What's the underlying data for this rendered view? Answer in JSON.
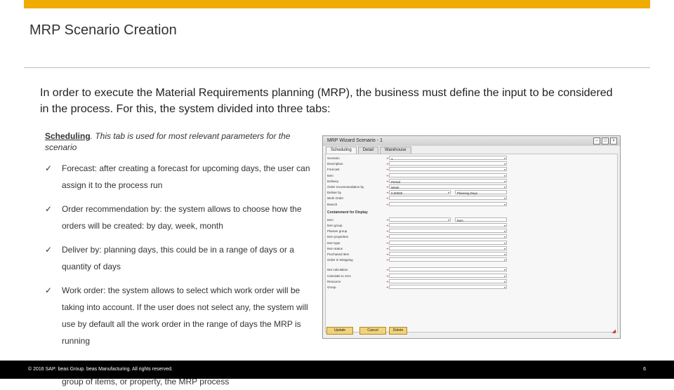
{
  "slide": {
    "title": "MRP Scenario Creation",
    "intro": "In order to execute the Material Requirements planning (MRP), the business must define the input to be considered in the process. For this, the system divided into three tabs:",
    "brand_color": "#f0ab00"
  },
  "scheduling": {
    "heading_underlined": "Scheduling",
    "heading_rest": ". This tab is used for most relevant parameters for the scenario",
    "bullets": [
      "Forecast: after creating a forecast for upcoming days, the user can assign it to the process run",
      "Order recommendation by: the system allows to choose how the orders will be created: by day, week, month",
      "Deliver by: planning days, this could be in a range of days or a quantity of days",
      "Work order: the system allows to select which work order will be taking into account. If the user does not select any, the system will use by default all the work order in the range of days the MRP is running",
      "Containment for display: in this part, the user can filter by item, group of items, or property, the MRP process"
    ],
    "check_glyph": "✓"
  },
  "wizard": {
    "title": "MRP Wizard Scenario - 1",
    "tabs": [
      "Scheduling",
      "Detail",
      "Warehouse"
    ],
    "fields": [
      {
        "label": "Scenario",
        "value": "1"
      },
      {
        "label": "Description",
        "value": ""
      },
      {
        "label": "Forecast",
        "value": ""
      },
      {
        "label": "Item",
        "value": ""
      },
      {
        "label": "Delivery",
        "value": "Period"
      },
      {
        "label": "Order recommendation by",
        "value": "Week"
      },
      {
        "label": "Deliver by",
        "value": "0.00000",
        "value2": "Planning Days"
      },
      {
        "label": "Work Order",
        "value": ""
      },
      {
        "label": "Branch",
        "value": ""
      }
    ],
    "section": "Containment for Display",
    "section_fields": [
      {
        "label": "Item",
        "value": "",
        "value2": "Item"
      },
      {
        "label": "Item group",
        "value": ""
      },
      {
        "label": "Planner group",
        "value": ""
      },
      {
        "label": "Item properties",
        "value": ""
      },
      {
        "label": "Item type",
        "value": ""
      },
      {
        "label": "Item status",
        "value": ""
      },
      {
        "label": "Purchased item",
        "value": ""
      },
      {
        "label": "Order in Wrapping",
        "value": ""
      }
    ],
    "extra_fields": [
      {
        "label": "Net calculation",
        "value": ""
      },
      {
        "label": "Calculate to zero",
        "value": ""
      },
      {
        "label": "Resource",
        "value": ""
      },
      {
        "label": "Group",
        "value": ""
      }
    ],
    "buttons": [
      "Update",
      "Cancel",
      "Delete"
    ]
  },
  "footer": {
    "copyright": "© 2016 SAP: beas Group. beas Manufacturing.  All rights reserved.",
    "page_number": "6"
  }
}
